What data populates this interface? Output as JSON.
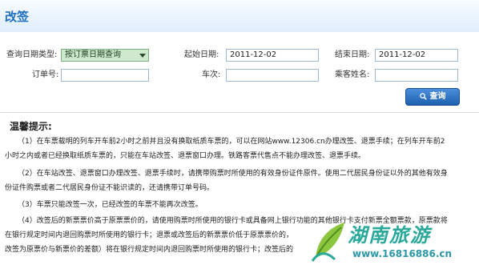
{
  "header": {
    "title": "改签"
  },
  "form": {
    "query_type_label": "查询日期类型:",
    "query_type_value": "按订票日期查询",
    "start_date_label": "起始日期:",
    "start_date_value": "2011-12-02",
    "end_date_label": "结束日期:",
    "end_date_value": "2011-12-02",
    "order_no_label": "订单号:",
    "order_no_value": "",
    "train_no_label": "车次:",
    "train_no_value": "",
    "passenger_label": "乘客姓名:",
    "passenger_value": "",
    "query_button": "查询"
  },
  "tips": {
    "title": "温馨提示:",
    "lines": [
      "（1）在车票载明的列车开车前2小时之前并且没有换取纸质车票的，可以在网站www.12306.cn办理改签、退票手续；在列车开车前2",
      "小时之内或者已经换取纸质车票的，只能在车站改签、退票窗口办理。铁路客票代售点不能办理改签、退票手续。",
      "（2）在车站改签、退票窗口办理改签、退票手续时，请携带购票时所使用的有效身份证件原件。使用二代居民身份证以外的其他有效身",
      "份证件购票或者二代居民身份证不能识读的，还请携带订单号码。",
      "（3）车票只能改签一次，已经改签的车票不能再次改签。",
      "（4）改签后的新票票价高于原票票价的，请使用购票时所使用的银行卡或具备网上银行功能的其他银行卡支付新票全额票款，原票款将",
      "在银行规定时间内退回购票时所使用的银行卡；退票或改签后的新票票价低于原票票价的，",
      "改签为原票价与新票价的差额）将在银行规定时间内退回购票时所使用的银行卡；改签后的"
    ]
  },
  "watermark": {
    "text": "湖南旅游",
    "url": "www.16816886.cn"
  }
}
